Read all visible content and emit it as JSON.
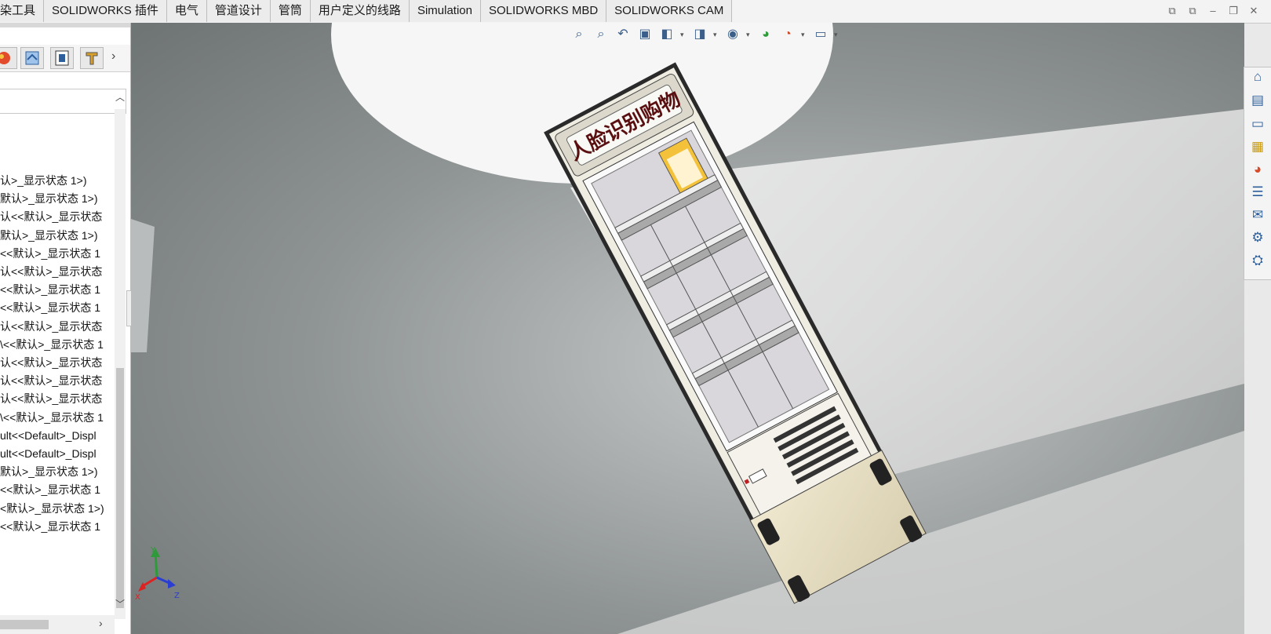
{
  "tabs": [
    "染工具",
    "SOLIDWORKS 插件",
    "电气",
    "管道设计",
    "管筒",
    "用户定义的线路",
    "Simulation",
    "SOLIDWORKS MBD",
    "SOLIDWORKS CAM"
  ],
  "tree_items": [
    "认>_显示状态 1>)",
    "默认>_显示状态 1>)",
    "认<<默认>_显示状态",
    "默认>_显示状态 1>)",
    "<<默认>_显示状态 1",
    "认<<默认>_显示状态",
    "<<默认>_显示状态 1",
    "<<默认>_显示状态 1",
    "认<<默认>_显示状态",
    "\\<<默认>_显示状态 1",
    "认<<默认>_显示状态",
    "认<<默认>_显示状态",
    "认<<默认>_显示状态",
    "\\<<默认>_显示状态 1",
    "ult<<Default>_Displ",
    "ult<<Default>_Displ",
    "默认>_显示状态 1>)",
    "<<默认>_显示状态 1",
    "<默认>_显示状态 1>)",
    "<<默认>_显示状态 1"
  ],
  "model_sign_text": "人脸识别购物",
  "triad": {
    "x": "X",
    "y": "Y",
    "z": "Z"
  },
  "colors": {
    "viewport_bg": "#9a9e9e",
    "cabinet_frame": "#efece1",
    "glass": "#d9d7dc",
    "base": "#e4dcc2",
    "sign_text": "#5a1010",
    "accent_blue": "#2a6bd1"
  },
  "icons": {
    "hud": [
      "zoom-to-fit-icon",
      "zoom-area-icon",
      "previous-view-icon",
      "section-view-icon",
      "view-orientation-icon",
      "display-style-icon",
      "hide-show-icon",
      "edit-appearance-icon",
      "apply-scene-icon",
      "view-settings-icon"
    ],
    "task_pane": [
      "home-icon",
      "design-library-icon",
      "file-explorer-icon",
      "view-palette-icon",
      "appearances-icon",
      "custom-properties-icon",
      "forum-icon",
      "toolbox-icon",
      "solidworks-resources-icon"
    ],
    "window": [
      "restore-left-icon",
      "restore-right-icon",
      "minimize-icon",
      "maximize-icon",
      "close-icon"
    ]
  }
}
